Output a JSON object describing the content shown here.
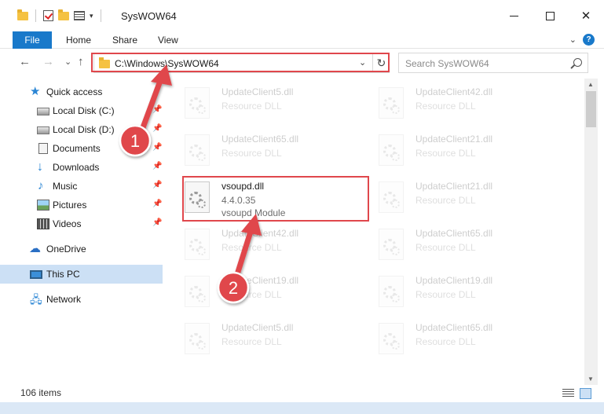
{
  "window": {
    "title": "SysWOW64",
    "quick_access_dropdown": "▾",
    "minimize": "",
    "maximize": "",
    "close": "✕"
  },
  "ribbon": {
    "tabs": [
      "File",
      "Home",
      "Share",
      "View"
    ],
    "help": "?",
    "expand": "⌄",
    "accent_color": "#1979ca"
  },
  "address": {
    "back": "←",
    "forward": "→",
    "recent": "⌄",
    "up": "↑",
    "path": "C:\\Windows\\SysWOW64",
    "dropdown": "⌄",
    "refresh": "↻"
  },
  "search": {
    "placeholder": "Search SysWOW64"
  },
  "sidebar": {
    "items": [
      {
        "label": "Quick access",
        "icon": "star-icon",
        "pinned": false
      },
      {
        "label": "Local Disk (C:)",
        "icon": "disk-icon",
        "pinned": true
      },
      {
        "label": "Local Disk (D:)",
        "icon": "disk-icon",
        "pinned": true
      },
      {
        "label": "Documents",
        "icon": "documents-icon",
        "pinned": true
      },
      {
        "label": "Downloads",
        "icon": "download-icon",
        "pinned": true
      },
      {
        "label": "Music",
        "icon": "music-icon",
        "pinned": true
      },
      {
        "label": "Pictures",
        "icon": "pictures-icon",
        "pinned": true
      },
      {
        "label": "Videos",
        "icon": "videos-icon",
        "pinned": true
      },
      {
        "label": "OneDrive",
        "icon": "cloud-icon",
        "pinned": false
      },
      {
        "label": "This PC",
        "icon": "pc-icon",
        "pinned": false,
        "selected": true
      },
      {
        "label": "Network",
        "icon": "network-icon",
        "pinned": false
      }
    ],
    "pin_glyph": "📌"
  },
  "files": {
    "left": [
      {
        "name": "UpdateClient5.dll",
        "line2": "Resource DLL",
        "line3": "",
        "faded": true
      },
      {
        "name": "UpdateClient65.dll",
        "line2": "Resource DLL",
        "line3": "",
        "faded": true
      },
      {
        "name": "vsoupd.dll",
        "line2": "4.4.0.35",
        "line3": "vsoupd Module",
        "faded": false
      },
      {
        "name": "UpdateClient42.dll",
        "line2": "Resource DLL",
        "line3": "",
        "faded": true
      },
      {
        "name": "UpdateClient19.dll",
        "line2": "Resource DLL",
        "line3": "",
        "faded": true
      },
      {
        "name": "UpdateClient5.dll",
        "line2": "Resource DLL",
        "line3": "",
        "faded": true
      }
    ],
    "right": [
      {
        "name": "UpdateClient42.dll",
        "line2": "Resource DLL",
        "faded": true
      },
      {
        "name": "UpdateClient21.dll",
        "line2": "Resource DLL",
        "faded": true
      },
      {
        "name": "UpdateClient21.dll",
        "line2": "Resource DLL",
        "faded": true
      },
      {
        "name": "UpdateClient65.dll",
        "line2": "Resource DLL",
        "faded": true
      },
      {
        "name": "UpdateClient19.dll",
        "line2": "Resource DLL",
        "faded": true
      },
      {
        "name": "UpdateClient65.dll",
        "line2": "Resource DLL",
        "faded": true
      }
    ]
  },
  "status": {
    "item_count": "106 items"
  },
  "annotations": {
    "step1": "1",
    "step2": "2",
    "color": "#e0474c"
  }
}
